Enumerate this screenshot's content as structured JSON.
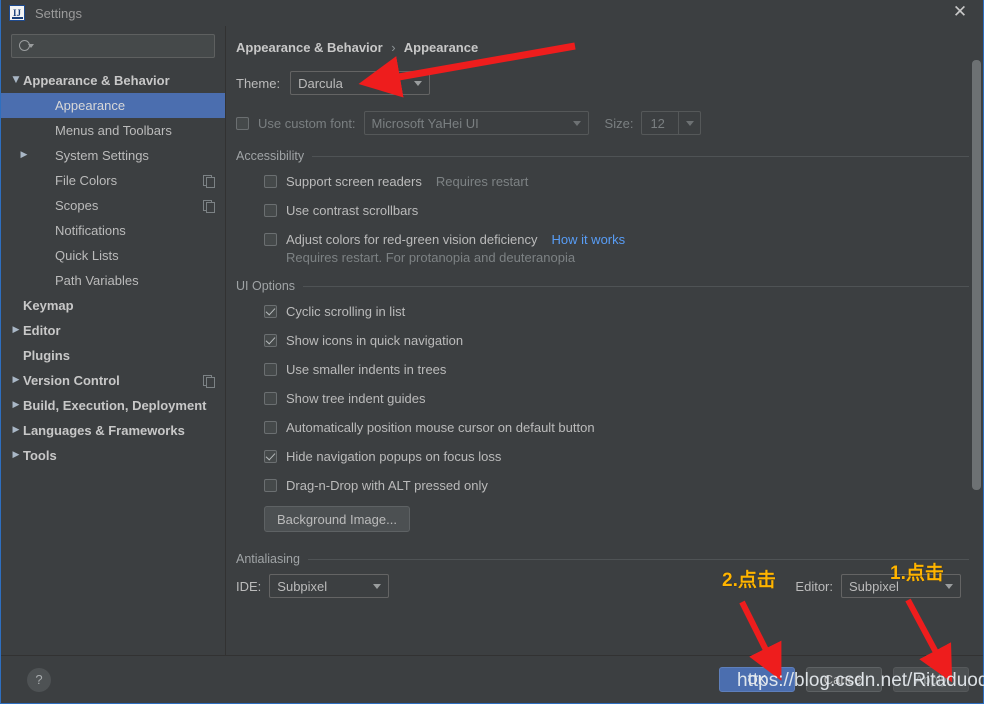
{
  "window": {
    "title": "Settings",
    "logo_icon": "intellij-idea-logo",
    "close_icon": "close-icon"
  },
  "sidebar": {
    "search": {
      "placeholder": "",
      "value": "",
      "icon": "search-icon"
    },
    "items": [
      {
        "label": "Appearance & Behavior",
        "arrow": "▼",
        "indent": 0,
        "bold": true,
        "selected": false,
        "extra_icon": null
      },
      {
        "label": "Appearance",
        "arrow": "",
        "indent": 1,
        "bold": false,
        "selected": true,
        "extra_icon": null
      },
      {
        "label": "Menus and Toolbars",
        "arrow": "",
        "indent": 1,
        "bold": false,
        "selected": false,
        "extra_icon": null
      },
      {
        "label": "System Settings",
        "arrow": "▶",
        "indent": 1,
        "bold": false,
        "selected": false,
        "extra_icon": null
      },
      {
        "label": "File Colors",
        "arrow": "",
        "indent": 1,
        "bold": false,
        "selected": false,
        "extra_icon": "copy-icon"
      },
      {
        "label": "Scopes",
        "arrow": "",
        "indent": 1,
        "bold": false,
        "selected": false,
        "extra_icon": "copy-icon"
      },
      {
        "label": "Notifications",
        "arrow": "",
        "indent": 1,
        "bold": false,
        "selected": false,
        "extra_icon": null
      },
      {
        "label": "Quick Lists",
        "arrow": "",
        "indent": 1,
        "bold": false,
        "selected": false,
        "extra_icon": null
      },
      {
        "label": "Path Variables",
        "arrow": "",
        "indent": 1,
        "bold": false,
        "selected": false,
        "extra_icon": null
      },
      {
        "label": "Keymap",
        "arrow": "",
        "indent": 0,
        "bold": true,
        "selected": false,
        "extra_icon": null
      },
      {
        "label": "Editor",
        "arrow": "▶",
        "indent": 0,
        "bold": true,
        "selected": false,
        "extra_icon": null
      },
      {
        "label": "Plugins",
        "arrow": "",
        "indent": 0,
        "bold": true,
        "selected": false,
        "extra_icon": null
      },
      {
        "label": "Version Control",
        "arrow": "▶",
        "indent": 0,
        "bold": true,
        "selected": false,
        "extra_icon": "copy-icon"
      },
      {
        "label": "Build, Execution, Deployment",
        "arrow": "▶",
        "indent": 0,
        "bold": true,
        "selected": false,
        "extra_icon": null
      },
      {
        "label": "Languages & Frameworks",
        "arrow": "▶",
        "indent": 0,
        "bold": true,
        "selected": false,
        "extra_icon": null
      },
      {
        "label": "Tools",
        "arrow": "▶",
        "indent": 0,
        "bold": true,
        "selected": false,
        "extra_icon": null
      }
    ]
  },
  "main": {
    "breadcrumb": {
      "parent": "Appearance & Behavior",
      "separator": "›",
      "current": "Appearance"
    },
    "theme": {
      "label": "Theme:",
      "value": "Darcula"
    },
    "custom_font": {
      "checkbox_label": "Use custom font:",
      "checked": false,
      "font_value": "Microsoft YaHei UI",
      "size_label": "Size:",
      "size_value": "12"
    },
    "accessibility": {
      "title": "Accessibility",
      "items": [
        {
          "label": "Support screen readers",
          "checked": false,
          "hint": "Requires restart",
          "link": ""
        },
        {
          "label": "Use contrast scrollbars",
          "checked": false,
          "hint": "",
          "link": ""
        },
        {
          "label": "Adjust colors for red-green vision deficiency",
          "checked": false,
          "hint": "",
          "link": "How it works"
        }
      ],
      "subhint": "Requires restart. For protanopia and deuteranopia"
    },
    "ui_options": {
      "title": "UI Options",
      "items": [
        {
          "label": "Cyclic scrolling in list",
          "checked": true
        },
        {
          "label": "Show icons in quick navigation",
          "checked": true
        },
        {
          "label": "Use smaller indents in trees",
          "checked": false
        },
        {
          "label": "Show tree indent guides",
          "checked": false
        },
        {
          "label": "Automatically position mouse cursor on default button",
          "checked": false
        },
        {
          "label": "Hide navigation popups on focus loss",
          "checked": true
        },
        {
          "label": "Drag-n-Drop with ALT pressed only",
          "checked": false
        }
      ],
      "background_image_button": "Background Image..."
    },
    "antialiasing": {
      "title": "Antialiasing",
      "ide_label": "IDE:",
      "ide_value": "Subpixel",
      "editor_label": "Editor:",
      "editor_value": "Subpixel"
    }
  },
  "footer": {
    "help_label": "?",
    "buttons": [
      {
        "label": "OK",
        "style": "primary"
      },
      {
        "label": "Cancel",
        "style": "normal"
      },
      {
        "label": "Apply",
        "style": "dim"
      }
    ]
  },
  "annotations": {
    "step1": "1.点击",
    "step2": "2.点击",
    "arrow_color": "#ee1d1d",
    "text_color": "#ffb400"
  },
  "watermark": "https://blog.csdn.net/Ritaduoduo"
}
